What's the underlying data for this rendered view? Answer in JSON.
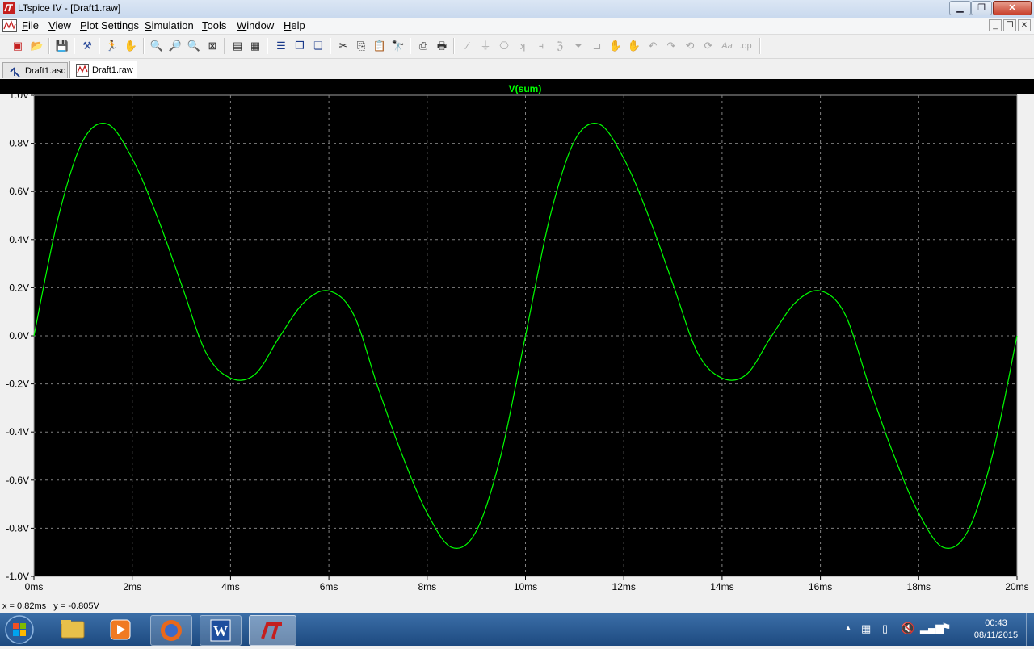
{
  "window": {
    "title": "LTspice IV - [Draft1.raw]",
    "minimize_icon": "minimize-icon",
    "maximize_icon": "restore-icon",
    "close_icon": "close-icon"
  },
  "menu": {
    "items": [
      "File",
      "View",
      "Plot Settings",
      "Simulation",
      "Tools",
      "Window",
      "Help"
    ]
  },
  "tabs": [
    {
      "label": "Draft1.asc",
      "icon": "schematic-icon",
      "active": false
    },
    {
      "label": "Draft1.raw",
      "icon": "waveform-icon",
      "active": true
    }
  ],
  "status": {
    "cursor_readout": "x = 0.82ms   y = -0.805V"
  },
  "taskbar": {
    "time": "00:43",
    "date": "08/11/2015"
  },
  "colors": {
    "trace": "#00ff00",
    "plot_background": "#000000",
    "grid": "#808080",
    "axis_text": "#000000"
  },
  "chart_data": {
    "type": "line",
    "title": "V(sum)",
    "xlabel": "",
    "ylabel": "",
    "xlim": [
      0,
      20
    ],
    "ylim": [
      -1.0,
      1.0
    ],
    "x_unit": "ms",
    "y_unit": "V",
    "x_ticks": [
      "0ms",
      "2ms",
      "4ms",
      "6ms",
      "8ms",
      "10ms",
      "12ms",
      "14ms",
      "16ms",
      "18ms",
      "20ms"
    ],
    "y_ticks": [
      "1.0V",
      "0.8V",
      "0.6V",
      "0.4V",
      "0.2V",
      "0.0V",
      "-0.2V",
      "-0.4V",
      "-0.6V",
      "-0.8V",
      "-1.0V"
    ],
    "grid": true,
    "series": [
      {
        "name": "V(sum)",
        "x": [
          0,
          0.5,
          1.0,
          1.5,
          2.0,
          2.5,
          3.0,
          3.5,
          4.0,
          4.5,
          5.0,
          5.5,
          6.0,
          6.5,
          7.0,
          7.5,
          8.0,
          8.5,
          9.0,
          9.5,
          10.0,
          10.5,
          11.0,
          11.5,
          12.0,
          12.5,
          13.0,
          13.5,
          14.0,
          14.5,
          15.0,
          15.5,
          16.0,
          16.5,
          17.0,
          17.5,
          18.0,
          18.5,
          19.0,
          19.5,
          20.0
        ],
        "y": [
          0.0,
          0.496,
          0.812,
          0.88,
          0.737,
          0.5,
          0.215,
          -0.07,
          -0.176,
          -0.16,
          -0.003,
          0.14,
          0.187,
          0.09,
          -0.215,
          -0.5,
          -0.737,
          -0.88,
          -0.812,
          -0.496,
          0.0,
          0.496,
          0.812,
          0.88,
          0.737,
          0.5,
          0.215,
          -0.07,
          -0.176,
          -0.16,
          -0.003,
          0.14,
          0.187,
          0.09,
          -0.215,
          -0.5,
          -0.737,
          -0.88,
          -0.812,
          -0.496,
          0.0
        ]
      }
    ]
  }
}
